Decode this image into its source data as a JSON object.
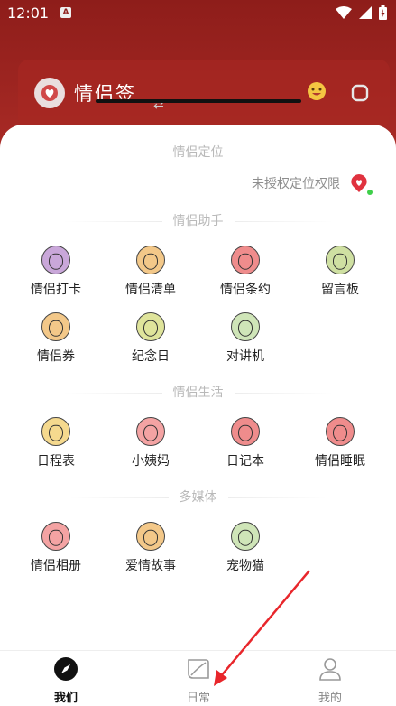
{
  "status_bar": {
    "time": "12:01",
    "notification_icon": "A",
    "icons": [
      "wifi-icon",
      "signal-icon",
      "battery-icon"
    ]
  },
  "header": {
    "app_title": "情侣签"
  },
  "sections": {
    "location": {
      "title": "情侣定位",
      "status_text": "未授权定位权限"
    },
    "assistant": {
      "title": "情侣助手",
      "items": [
        {
          "label": "情侣打卡",
          "icon": "eggplant-icon",
          "color": "#c9a7d9"
        },
        {
          "label": "情侣清单",
          "icon": "orange-icon",
          "color": "#f3c889"
        },
        {
          "label": "情侣条约",
          "icon": "tomato-icon",
          "color": "#ef8c8c"
        },
        {
          "label": "留言板",
          "icon": "pear-icon",
          "color": "#cfe0a2"
        },
        {
          "label": "情侣券",
          "icon": "mushroom-icon",
          "color": "#f3c889"
        },
        {
          "label": "纪念日",
          "icon": "lemon-icon",
          "color": "#dfe49b"
        },
        {
          "label": "对讲机",
          "icon": "cabbage-icon",
          "color": "#cfe5b8"
        }
      ]
    },
    "life": {
      "title": "情侣生活",
      "items": [
        {
          "label": "日程表",
          "icon": "carrot-icon",
          "color": "#f5d98e"
        },
        {
          "label": "小姨妈",
          "icon": "peach-icon",
          "color": "#f4a3a3"
        },
        {
          "label": "日记本",
          "icon": "apple-icon",
          "color": "#ef8c8c"
        },
        {
          "label": "情侣睡眠",
          "icon": "tomato-icon",
          "color": "#ef8c8c"
        }
      ]
    },
    "media": {
      "title": "多媒体",
      "items": [
        {
          "label": "情侣相册",
          "icon": "strawberry-icon",
          "color": "#f4a3a3"
        },
        {
          "label": "爱情故事",
          "icon": "pineapple-icon",
          "color": "#f3c889"
        },
        {
          "label": "宠物猫",
          "icon": "watermelon-icon",
          "color": "#cfe5b8"
        }
      ]
    }
  },
  "bottom_nav": {
    "items": [
      {
        "label": "我们",
        "icon": "compass-icon",
        "active": true
      },
      {
        "label": "日常",
        "icon": "leaf-icon",
        "active": false
      },
      {
        "label": "我的",
        "icon": "user-icon",
        "active": false
      }
    ]
  },
  "colors": {
    "accent": "#e0323f",
    "annotation_arrow": "#e8262b"
  }
}
